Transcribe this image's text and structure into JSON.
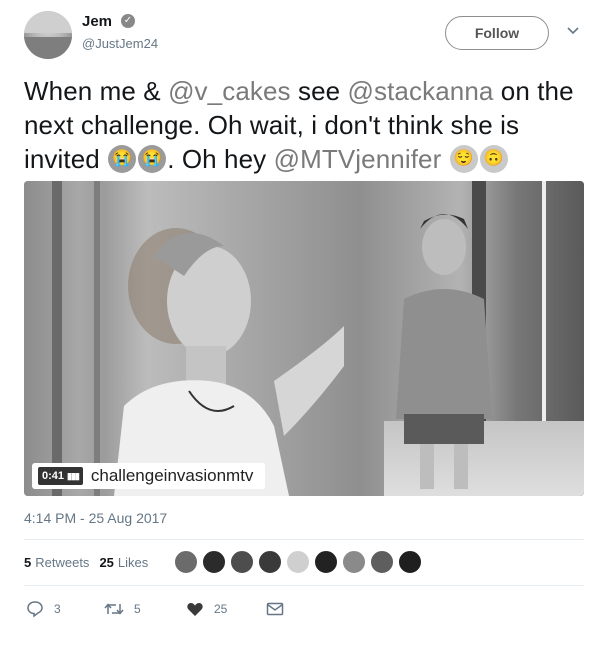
{
  "user": {
    "name": "Jem",
    "handle": "@JustJem24",
    "verified_glyph": "✓"
  },
  "follow_label": "Follow",
  "tweet": {
    "p1": "When me & ",
    "m1": "@v_cakes",
    "p2": " see ",
    "m2": "@stackanna",
    "p3": " on the next challenge. Oh wait, i don't think she is invited ",
    "p4": ". Oh hey ",
    "m3": "@MTVjennifer",
    "emojis": [
      "loudly-crying-face",
      "loudly-crying-face",
      "relieved-face",
      "upside-down-face"
    ]
  },
  "media": {
    "duration": "0:41",
    "channel": "challengeinvasionmtv"
  },
  "timestamp": "4:14 PM - 25 Aug 2017",
  "stats": {
    "retweets_count": "5",
    "retweets_label": "Retweets",
    "likes_count": "25",
    "likes_label": "Likes"
  },
  "actions": {
    "reply_count": "3",
    "retweet_count": "5",
    "like_count": "25"
  },
  "colors": {
    "text": "#14171a",
    "secondary": "#657786",
    "mention": "#7a7a7a"
  }
}
